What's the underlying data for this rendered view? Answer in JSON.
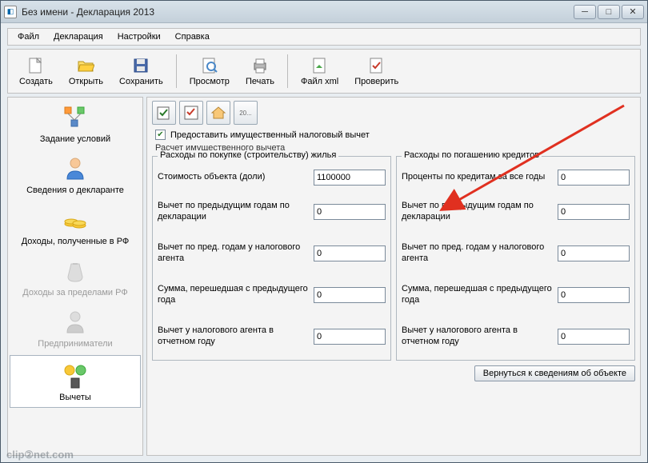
{
  "window": {
    "title": "Без имени - Декларация 2013"
  },
  "menu": {
    "file": "Файл",
    "decl": "Декларация",
    "settings": "Настройки",
    "help": "Справка"
  },
  "toolbar": {
    "create": "Создать",
    "open": "Открыть",
    "save": "Сохранить",
    "preview": "Просмотр",
    "print": "Печать",
    "xml": "Файл xml",
    "check": "Проверить"
  },
  "sidebar": {
    "items": [
      {
        "label": "Задание условий"
      },
      {
        "label": "Сведения о декларанте"
      },
      {
        "label": "Доходы, полученные в РФ"
      },
      {
        "label": "Доходы за пределами РФ"
      },
      {
        "label": "Предприниматели"
      },
      {
        "label": "Вычеты"
      }
    ]
  },
  "content": {
    "mini": {
      "page_hint": "20..."
    },
    "checkbox_label": "Предоставить имущественный налоговый вычет",
    "calc_title": "Расчет имущественного вычета",
    "left": {
      "title": "Расходы по покупке (строительству) жилья",
      "rows": [
        {
          "label": "Стоимость объекта (доли)",
          "value": "1100000"
        },
        {
          "label": "Вычет по предыдущим годам по декларации",
          "value": "0"
        },
        {
          "label": "Вычет по пред. годам у налогового агента",
          "value": "0"
        },
        {
          "label": "Сумма, перешедшая с предыдущего года",
          "value": "0"
        },
        {
          "label": "Вычет у налогового агента в отчетном году",
          "value": "0"
        }
      ]
    },
    "right": {
      "title": "Расходы по погашению кредитов",
      "rows": [
        {
          "label": "Проценты по кредитам за все годы",
          "value": "0"
        },
        {
          "label": "Вычет по предыдущим годам по декларации",
          "value": "0"
        },
        {
          "label": "Вычет по пред. годам у налогового агента",
          "value": "0"
        },
        {
          "label": "Сумма, перешедшая с предыдущего года",
          "value": "0"
        },
        {
          "label": "Вычет у налогового агента в отчетном году",
          "value": "0"
        }
      ]
    },
    "back_button": "Вернуться к сведениям об объекте"
  },
  "watermark": "clip②net.com"
}
